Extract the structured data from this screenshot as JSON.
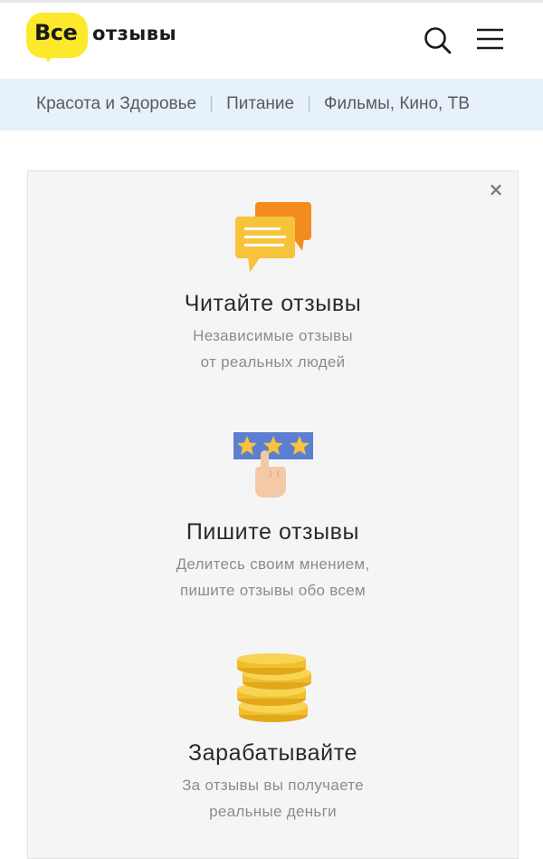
{
  "header": {
    "logo_badge": "Все",
    "logo_text": "отзывы",
    "search_icon": "search-icon",
    "menu_icon": "hamburger-menu-icon"
  },
  "categories": [
    {
      "label": "Красота и Здоровье"
    },
    {
      "label": "Питание"
    },
    {
      "label": "Фильмы, Кино, ТВ"
    }
  ],
  "promo": {
    "close_icon": "close-icon",
    "features": [
      {
        "icon": "chat-bubbles-icon",
        "title": "Читайте отзывы",
        "desc_line1": "Независимые отзывы",
        "desc_line2": "от реальных людей"
      },
      {
        "icon": "star-rating-hand-icon",
        "title": "Пишите отзывы",
        "desc_line1": "Делитесь своим мнением,",
        "desc_line2": "пишите отзывы обо всем"
      },
      {
        "icon": "coins-stack-icon",
        "title": "Зарабатывайте",
        "desc_line1": "За отзывы вы получаете",
        "desc_line2": "реальные деньги"
      }
    ]
  },
  "colors": {
    "logo_yellow": "#fde92b",
    "category_bg": "#e6f1fb",
    "card_bg": "#f5f5f5"
  }
}
